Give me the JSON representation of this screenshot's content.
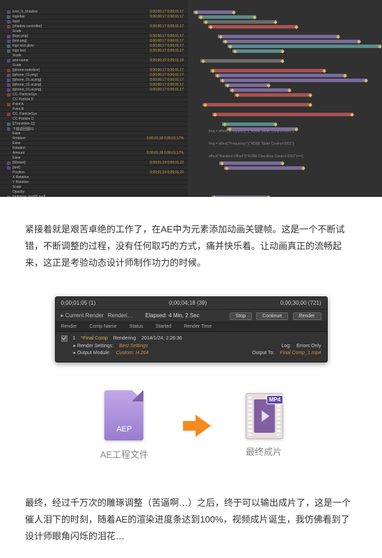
{
  "timeline": {
    "rows": [
      {
        "name": "Icon_9_Shadow",
        "type": "purple",
        "times": "0;00;00;17 0;00;01;17"
      },
      {
        "name": "logo/bar",
        "type": "teal",
        "times": "0;00;00;17 0;00;01;17"
      },
      {
        "name": "layer",
        "type": "grey",
        "times": ""
      },
      {
        "name": "[shadow controller]",
        "type": "red",
        "times": "0;00;00;17 0;00;01;17"
      },
      {
        "name": "Scale",
        "type": "",
        "times": ""
      },
      {
        "name": "[logo.png]",
        "type": "purple",
        "times": "0;00;00;17 0;00;01;17"
      },
      {
        "name": "[text.png]",
        "type": "purple",
        "times": "0;00;00;17 0;00;01;17"
      },
      {
        "name": "logo text glow",
        "type": "teal",
        "times": "0;00;00;17 0;00;01;17"
      },
      {
        "name": "logo text",
        "type": "teal",
        "times": "0;00;00;17 0;00;01;17"
      },
      {
        "name": "Scale",
        "type": "",
        "times": ""
      },
      {
        "name": "ann-name",
        "type": "grey",
        "times": "0;00;00;22 0;00;01;18"
      },
      {
        "name": "Scale",
        "type": "",
        "times": ""
      },
      {
        "name": "[iphone-outerbox]",
        "type": "red",
        "times": "0;00;00;17 0;00;01;17"
      },
      {
        "name": "[iphone_01.png]",
        "type": "purple",
        "times": "0;00;00;17 0;00;01;17"
      },
      {
        "name": "[iphone_01.ai.png]",
        "type": "purple",
        "times": "0;00;00;17 0;00;01;17"
      },
      {
        "name": "[iphone_01.ai.png]",
        "type": "purple",
        "times": "0;00;00;17 0;00;01;17"
      },
      {
        "name": "[iphone_01.ai.png]",
        "type": "purple",
        "times": "0;00;00;17 0;00;01;17"
      },
      {
        "name": "CC. ParticleSys",
        "type": "red",
        "times": ""
      },
      {
        "name": "CC Particle D",
        "type": "",
        "times": ""
      },
      {
        "name": "Point A",
        "type": "red",
        "times": ""
      },
      {
        "name": "Point B",
        "type": "",
        "times": ""
      },
      {
        "name": "CC. ParticleSys",
        "type": "red",
        "times": ""
      },
      {
        "name": "CC Particle D",
        "type": "",
        "times": ""
      },
      {
        "name": "[[Transition-1]]",
        "type": "teal",
        "times": ""
      },
      {
        "name": "下载返回图01",
        "type": "purple",
        "times": ""
      },
      {
        "name": "Ease",
        "type": "",
        "times": ""
      },
      {
        "name": "Rotation",
        "type": "",
        "times": "0;00;01;18  0;00;01;17%"
      },
      {
        "name": "Ease",
        "type": "",
        "times": ""
      },
      {
        "name": "Rotation",
        "type": "",
        "times": ""
      },
      {
        "name": "Amount",
        "type": "",
        "times": "0;00;01;18  0;00;01;17%"
      },
      {
        "name": "Ease",
        "type": "",
        "times": ""
      },
      {
        "name": "[Miniset]",
        "type": "purple",
        "times": "0;00;01;19 0;00;01;22"
      },
      {
        "name": "[text]",
        "type": "purple",
        "times": ""
      },
      {
        "name": "Position",
        "type": "",
        "times": "0;00;01;19 0;00;01;22"
      },
      {
        "name": "X Rotation",
        "type": "",
        "times": ""
      },
      {
        "name": "Y Rotation",
        "type": "",
        "times": ""
      },
      {
        "name": "Scale",
        "type": "",
        "times": ""
      },
      {
        "name": "Opacity",
        "type": "",
        "times": ""
      },
      {
        "name": "[optimize_text02.psd]",
        "type": "purple",
        "times": ""
      }
    ],
    "expressions": [
      "freq = effect(\"Frequency\")(\"ADBE Slider Control-0001\");",
      "freq = effect(\"Frequency\")(\"ADBE Slider Control-0001\");",
      "effect(\"Random Offset\")(\"ADBE Checkbox Control-0001\")==1;"
    ]
  },
  "paragraph1": "紧接着就是艰苦卓绝的工作了，在AE中为元素添加动画关键帧。这是一个不断试错，不断调整的过程，没有任何取巧的方式，痛并快乐着。让动画真正的流畅起来，这正是考验动态设计师制作功力的时候。",
  "render": {
    "time_left": "0;00;01;05 (1)",
    "time_mid": "0;00;04;18 (39)",
    "time_right": "0;00;30;00 (721)",
    "current_label": "▸ Current Render",
    "rendering_label": "Renderi…",
    "elapsed": "Elapsed: 4 Min, 2 Sec",
    "btn_stop": "Stop",
    "btn_continue": "Continue",
    "btn_render": "Render",
    "head": [
      "Render",
      "Comp Name",
      "Status",
      "Started",
      "Render Time"
    ],
    "comp_name": "*Final Comp",
    "status": "Rendering",
    "started": "2014/1/24, 2:26:36",
    "rs_label": "▸ Render Settings:",
    "rs_value": "Best Settings",
    "om_label": "▸ Output Module:",
    "om_value": "Custom: H.264",
    "log_label": "Log:",
    "log_value": "Errors Only",
    "out_label": "Output To:",
    "out_value": "Final Comp_1.mp4"
  },
  "files": {
    "aep_badge": "AEP",
    "aep_label": "AE工程文件",
    "mp4_tag": "MP4",
    "mp4_label": "最终成片"
  },
  "paragraph2": "最终，经过千万次的雕琢调整（苦逼啊…）之后，终于可以输出成片了，这是一个催人泪下的时刻，随着AE的渲染进度条达到100%，视频成片诞生，我仿佛看到了设计师眼角闪烁的泪花…"
}
